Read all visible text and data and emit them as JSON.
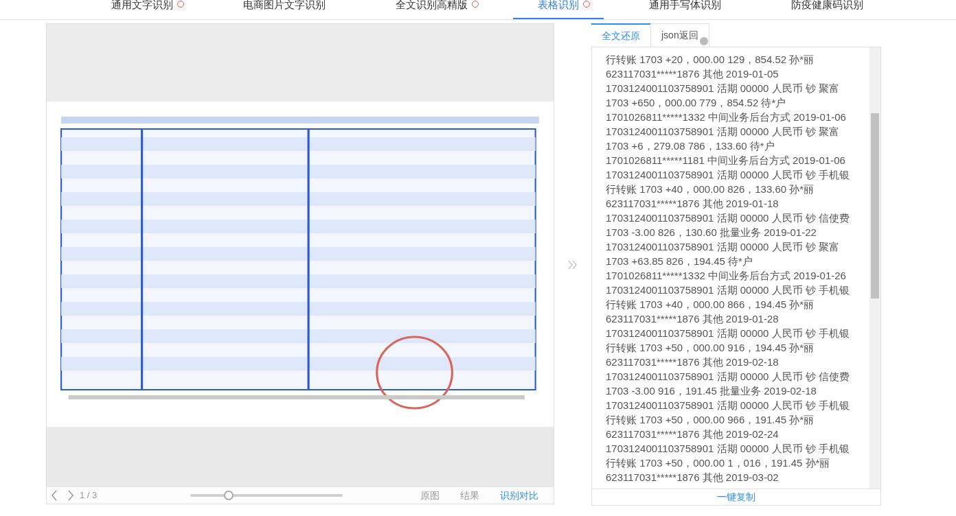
{
  "nav_tabs": [
    {
      "label": "通用文字识别",
      "selected": false,
      "badge": true
    },
    {
      "label": "电商图片文字识别",
      "selected": false,
      "badge": false
    },
    {
      "label": "全文识别高精版",
      "selected": false,
      "badge": true
    },
    {
      "label": "表格识别",
      "selected": true,
      "badge": true
    },
    {
      "label": "通用手写体识别",
      "selected": false,
      "badge": false
    },
    {
      "label": "防疫健康码识别",
      "selected": false,
      "badge": false
    }
  ],
  "viewer": {
    "page": "1 / 3",
    "zoom": {
      "level": 0.25
    },
    "modes": [
      {
        "label": "原图",
        "selected": false
      },
      {
        "label": "结果",
        "selected": false
      },
      {
        "label": "识别对比",
        "selected": true
      }
    ]
  },
  "result": {
    "tabs": [
      {
        "label": "全文还原",
        "selected": true,
        "help": false
      },
      {
        "label": "json返回",
        "selected": false,
        "help": true
      }
    ],
    "lines": [
      "行转账 1703 +20，000.00 129，854.52 孙*丽",
      "623117031*****1876 其他 2019-01-05",
      "1703124001103758901 活期 00000 人民币 钞 聚富",
      "1703 +650，000.00 779，854.52 待*户",
      "1701026811*****1332 中间业务后台方式 2019-01-06",
      "1703124001103758901 活期 00000 人民币 钞 聚富",
      "1703 +6，279.08 786，133.60 待*户",
      "1701026811*****1181 中间业务后台方式 2019-01-06",
      "1703124001103758901 活期 00000 人民币 钞 手机银",
      "行转账 1703 +40，000.00 826，133.60 孙*丽",
      "623117031*****1876 其他 2019-01-18",
      "1703124001103758901 活期 00000 人民币 钞 信使费",
      "1703 -3.00 826，130.60 批量业务 2019-01-22",
      "1703124001103758901 活期 00000 人民币 钞 聚富",
      "1703 +63.85 826，194.45 待*户",
      "1701026811*****1332 中间业务后台方式 2019-01-26",
      "1703124001103758901 活期 00000 人民币 钞 手机银",
      "行转账 1703 +40，000.00 866，194.45 孙*丽",
      "623117031*****1876 其他 2019-01-28",
      "1703124001103758901 活期 00000 人民币 钞 手机银",
      "行转账 1703 +50，000.00 916，194.45 孙*丽",
      "623117031*****1876 其他 2019-02-18",
      "1703124001103758901 活期 00000 人民币 钞 信使费",
      "1703 -3.00 916，191.45 批量业务 2019-02-18",
      "1703124001103758901 活期 00000 人民币 钞 手机银",
      "行转账 1703 +50，000.00 966，191.45 孙*丽",
      "623117031*****1876 其他 2019-02-24",
      "1703124001103758901 活期 00000 人民币 钞 手机银",
      "行转账 1703 +50，000.00 1，016，191.45 孙*丽",
      "623117031*****1876 其他 2019-03-02"
    ],
    "copy_button": "一键复制"
  }
}
